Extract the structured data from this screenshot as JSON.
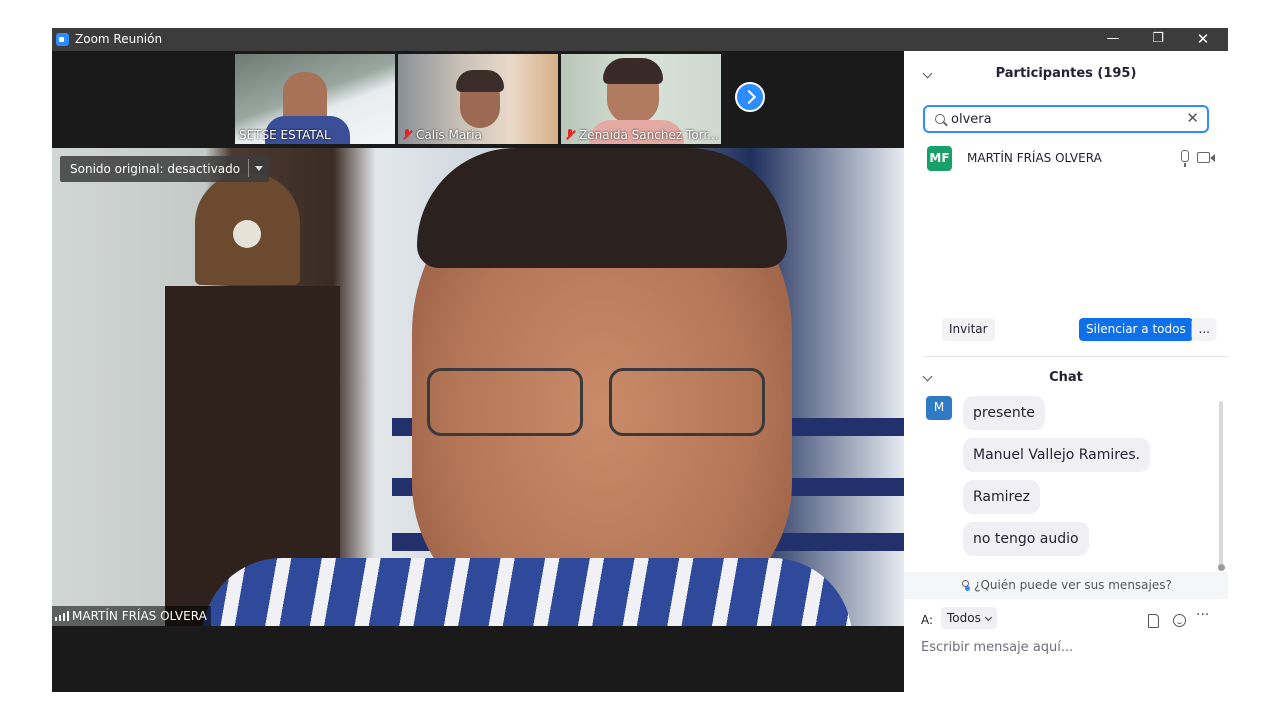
{
  "window": {
    "title": "Zoom Reunión",
    "minimize_glyph": "—",
    "maximize_glyph": "❐",
    "close_glyph": "✕"
  },
  "thumbnails": [
    {
      "name": "SETSE ESTATAL",
      "muted": false
    },
    {
      "name": "Calis Maria",
      "muted": true
    },
    {
      "name": "Zenaida Sanchez Torr...",
      "muted": true
    }
  ],
  "main_video": {
    "sound_label": "Sonido original: desactivado",
    "speaker_name": "MARTÍN FRÍAS OLVERA"
  },
  "participants_panel": {
    "title": "Participantes (195)",
    "search_value": "olvera",
    "clear_glyph": "✕",
    "results": [
      {
        "initials": "MF",
        "name": "MARTÍN FRÍAS OLVERA",
        "avatar_color": "#18a06b"
      }
    ],
    "invite_label": "Invitar",
    "mute_all_label": "Silenciar a todos",
    "more_label": "..."
  },
  "chat": {
    "title": "Chat",
    "sender_initial": "M",
    "messages": [
      "presente",
      "Manuel Vallejo Ramires.",
      "Ramirez",
      "no tengo audio"
    ],
    "who_can_see": "¿Quién puede ver sus mensajes?",
    "to_label": "A:",
    "to_value": "Todos",
    "more_glyph": "···",
    "compose_placeholder": "Escribir mensaje aquí..."
  },
  "colors": {
    "accent": "#2d8cff",
    "primary_button": "#0e71eb",
    "muted_icon": "#e02828"
  },
  "icons": {
    "app": "zoom-app-icon",
    "next": "chevron-right-icon",
    "search": "search-icon",
    "mic": "microphone-icon",
    "camera": "video-camera-icon",
    "file": "file-icon",
    "emoji": "emoji-icon"
  }
}
